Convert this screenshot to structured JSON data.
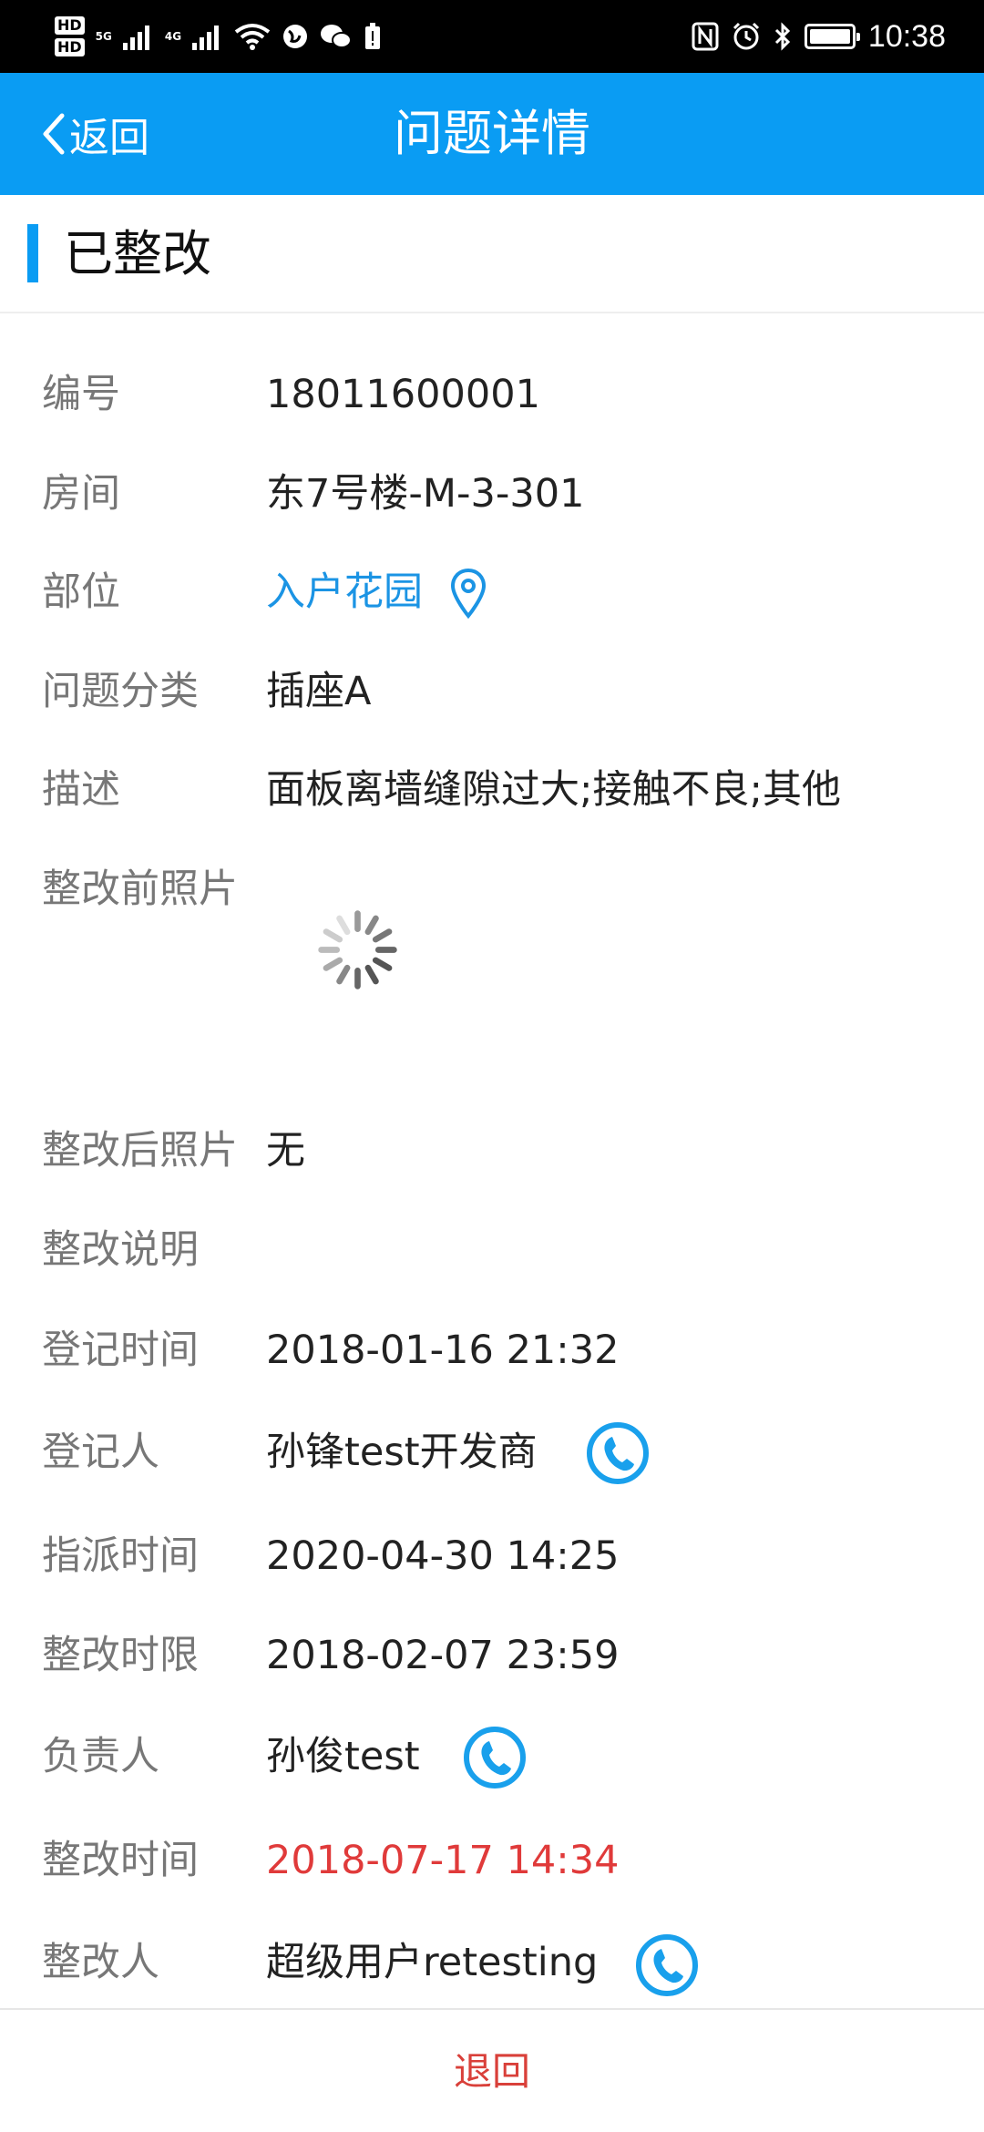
{
  "status_bar": {
    "hd1": "HD",
    "hd2": "HD",
    "net1": "5G",
    "net2": "4G",
    "time": "10:38"
  },
  "nav": {
    "back_label": "返回",
    "title": "问题详情"
  },
  "section": {
    "title": "已整改",
    "accent_color": "#0a9cf3"
  },
  "details": {
    "number": {
      "label": "编号",
      "value": "18011600001"
    },
    "room": {
      "label": "房间",
      "value": "东7号楼-M-3-301"
    },
    "position": {
      "label": "部位",
      "value": "入户花园"
    },
    "category": {
      "label": "问题分类",
      "value": "插座A"
    },
    "description": {
      "label": "描述",
      "value": "面板离墙缝隙过大;接触不良;其他"
    },
    "photos_before": {
      "label": "整改前照片"
    },
    "photos_after": {
      "label": "整改后照片",
      "value": "无"
    },
    "rectify_note": {
      "label": "整改说明",
      "value": ""
    },
    "register_time": {
      "label": "登记时间",
      "value": "2018-01-16 21:32"
    },
    "registrant": {
      "label": "登记人",
      "value": "孙锋test开发商"
    },
    "assign_time": {
      "label": "指派时间",
      "value": "2020-04-30 14:25"
    },
    "deadline": {
      "label": "整改时限",
      "value": "2018-02-07 23:59"
    },
    "owner": {
      "label": "负责人",
      "value": "孙俊test"
    },
    "rectify_time": {
      "label": "整改时间",
      "value": "2018-07-17 14:34"
    },
    "rectifier": {
      "label": "整改人",
      "value": "超级用户retesting"
    }
  },
  "bottom": {
    "back_label": "退回"
  },
  "colors": {
    "navbar": "#0a9cf3",
    "link_blue": "#1b94e4",
    "overdue_red": "#e03a3a",
    "bottom_red": "#d9403a"
  }
}
